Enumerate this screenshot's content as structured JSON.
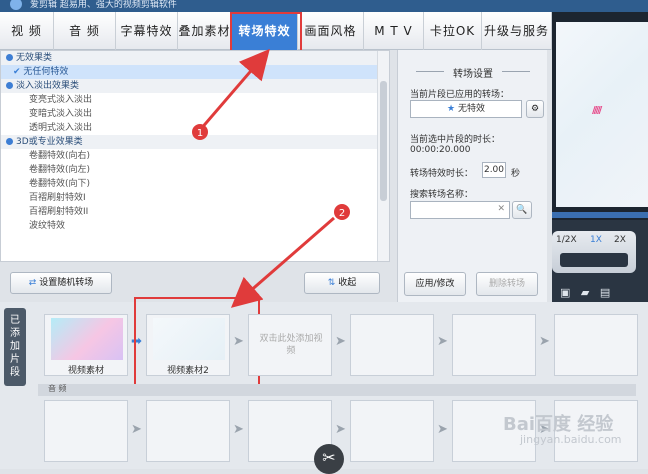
{
  "window": {
    "title_text": "爱剪辑    超易用、强大的视频剪辑软件"
  },
  "tabs": [
    {
      "label": "视 频"
    },
    {
      "label": "音 频"
    },
    {
      "label": "字幕特效"
    },
    {
      "label": "叠加素材"
    },
    {
      "label": "转场特效",
      "active": true
    },
    {
      "label": "画面风格"
    },
    {
      "label": "M T V"
    },
    {
      "label": "卡拉OK"
    },
    {
      "label": "升级与服务"
    }
  ],
  "effects_list": {
    "group1": "无效果类",
    "group1_item": "无任何特效",
    "group2": "淡入淡出效果类",
    "group2_items": [
      "变亮式淡入淡出",
      "变暗式淡入淡出",
      "透明式淡入淡出"
    ],
    "group3": "3D或专业效果类",
    "group3_items": [
      "卷翻特效(向右)",
      "卷翻特效(向左)",
      "卷翻特效(向下)",
      "百褶刷射特效I",
      "百褶刷射特效II",
      "波纹特效"
    ]
  },
  "buttons": {
    "random_transition": "设置随机转场",
    "collapse": "收起",
    "apply": "应用/修改",
    "delete": "删除转场"
  },
  "transition_settings": {
    "title": "转场设置",
    "applied_label": "当前片段已应用的转场：",
    "applied_value": "无特效",
    "duration_label": "当前选中片段的时长：",
    "duration_value": "00:00:20.000",
    "effect_duration_label": "转场特效时长：",
    "effect_duration_value": "2.00",
    "effect_duration_unit": "秒",
    "search_label": "搜索转场名称："
  },
  "player": {
    "speed_options": [
      "1/2X",
      "1X",
      "2X"
    ]
  },
  "timeline": {
    "added_clips_label": "已添加片段",
    "clips": [
      {
        "label": "视频素材"
      },
      {
        "label": "视频素材2"
      }
    ],
    "add_hint": "双击此处添加视频",
    "audio_label": "音 频"
  },
  "annotations": {
    "marker1": "1",
    "marker2": "2"
  },
  "watermark": {
    "brand": "Bai百度 经验",
    "url": "jingyan.baidu.com"
  },
  "colors": {
    "accent": "#3a7fd6",
    "highlight_box": "#e03b3b"
  }
}
